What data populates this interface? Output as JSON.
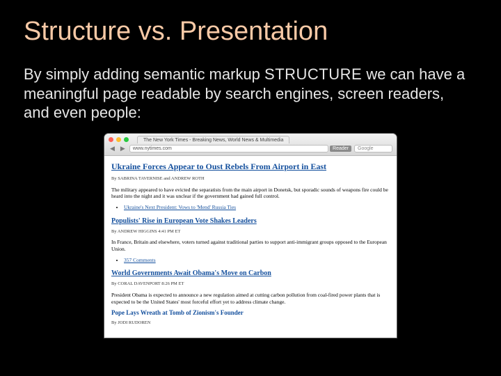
{
  "slide": {
    "title": "Structure vs. Presentation",
    "lead_pre": "By simply adding semantic markup ",
    "lead_emph": "STRUCTURE",
    "lead_post": " we can have a meaningful page readable by search engines, screen readers, and even people:"
  },
  "browser": {
    "tab_title": "The New York Times - Breaking News, World News & Multimedia",
    "address": "www.nytimes.com",
    "reader_label": "Reader",
    "search_placeholder": "Google"
  },
  "article": {
    "headline": "Ukraine Forces Appear to Oust Rebels From Airport in East",
    "byline1": "By SABRINA TAVERNISE and ANDREW ROTH",
    "para1": "The military appeared to have evicted the separatists from the main airport in Donetsk, but sporadic sounds of weapons fire could be heard into the night and it was unclear if the government had gained full control.",
    "link1": "Ukraine's Next President: Vows to 'Mend' Russia Ties",
    "h2a": "Populists' Rise in European Vote Shakes Leaders",
    "byline2": "By ANDREW HIGGINS 4:41 PM ET",
    "para2": "In France, Britain and elsewhere, voters turned against traditional parties to support anti-immigrant groups opposed to the European Union.",
    "link2": "357 Comments",
    "h2b": "World Governments Await Obama's Move on Carbon",
    "byline3": "By CORAL DAVENPORT 8:26 PM ET",
    "para3": "President Obama is expected to announce a new regulation aimed at cutting carbon pollution from coal-fired power plants that is expected to be the United States' most forceful effort yet to address climate change.",
    "h3a": "Pope Lays Wreath at Tomb of Zionism's Founder",
    "byline4": "By JODI RUDOREN"
  }
}
